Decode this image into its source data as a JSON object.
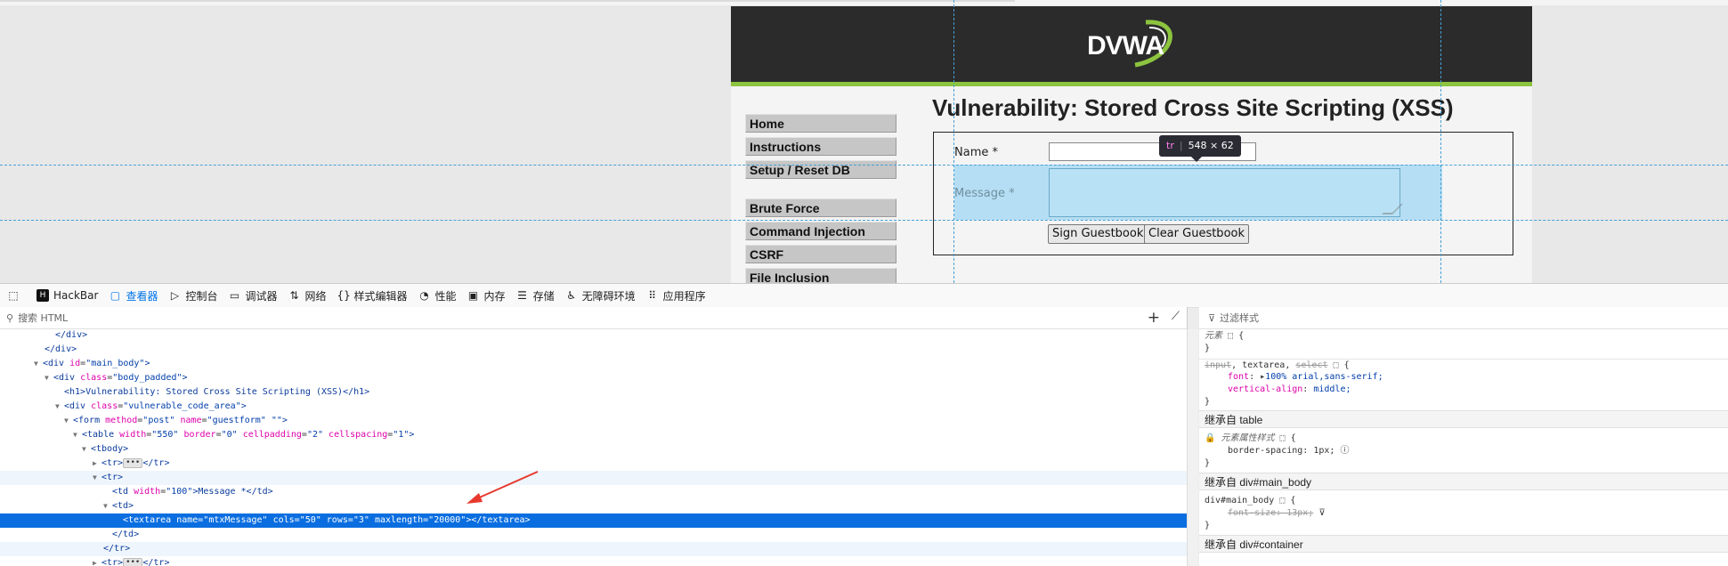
{
  "dvwa": {
    "logo_text": "DVWA",
    "menu": [
      "Home",
      "Instructions",
      "Setup / Reset DB",
      "Brute Force",
      "Command Injection",
      "CSRF",
      "File Inclusion"
    ],
    "title": "Vulnerability: Stored Cross Site Scripting (XSS)",
    "name_label": "Name *",
    "message_label": "Message *",
    "sign_button": "Sign Guestbook",
    "clear_button": "Clear Guestbook"
  },
  "tooltip": {
    "tag": "tr",
    "size": "548 × 62"
  },
  "devtools": {
    "tabs": [
      {
        "label": "HackBar",
        "icon": "hackbar-icon"
      },
      {
        "label": "查看器",
        "icon": "inspector-icon"
      },
      {
        "label": "控制台",
        "icon": "console-icon"
      },
      {
        "label": "调试器",
        "icon": "debugger-icon"
      },
      {
        "label": "网络",
        "icon": "network-icon"
      },
      {
        "label": "样式编辑器",
        "icon": "style-editor-icon"
      },
      {
        "label": "性能",
        "icon": "performance-icon"
      },
      {
        "label": "内存",
        "icon": "memory-icon"
      },
      {
        "label": "存储",
        "icon": "storage-icon"
      },
      {
        "label": "无障碍环境",
        "icon": "accessibility-icon"
      },
      {
        "label": "应用程序",
        "icon": "application-icon"
      }
    ],
    "active_tab": "查看器",
    "search_placeholder": "搜索 HTML",
    "filter_placeholder": "过滤样式"
  },
  "html_tree": {
    "l0": "</div>",
    "l1": "</div>",
    "l2_tag": "<div",
    "l2_an": "id",
    "l2_av": "\"main_body\"",
    "l2_end": ">",
    "l3_tag": "<div",
    "l3_an": "class",
    "l3_av": "\"body_padded\"",
    "l3_end": ">",
    "l4": "<h1>Vulnerability: Stored Cross Site Scripting (XSS)</h1>",
    "l5_tag": "<div",
    "l5_an": "class",
    "l5_av": "\"vulnerable_code_area\"",
    "l5_end": ">",
    "l6_tag": "<form",
    "l6_a1": "method",
    "l6_v1": "\"post\"",
    "l6_a2": "name",
    "l6_v2": "\"guestform\"",
    "l6_v3": "\"\"",
    "l6_end": ">",
    "l7_tag": "<table",
    "l7_a1": "width",
    "l7_v1": "\"550\"",
    "l7_a2": "border",
    "l7_v2": "\"0\"",
    "l7_a3": "cellpadding",
    "l7_v3": "\"2\"",
    "l7_a4": "cellspacing",
    "l7_v4": "\"1\"",
    "l7_end": ">",
    "l8": "<tbody>",
    "l9_open": "<tr>",
    "l9_close": "</tr>",
    "l10": "<tr>",
    "l11_tag": "<td",
    "l11_an": "width",
    "l11_av": "\"100\"",
    "l11_text": ">Message *</td>",
    "l12": "<td>",
    "l13": "<textarea name=\"mtxMessage\" cols=\"50\" rows=\"3\" maxlength=\"20000\"></textarea>",
    "l14": "</td>",
    "l15": "</tr>",
    "l16_open": "<tr>",
    "l16_close": "</tr>"
  },
  "styles": {
    "element_label": "元素",
    "rule1_selector_a": "input",
    "rule1_selector_b": ", textarea, ",
    "rule1_selector_c": "select",
    "rule1_p1": "font",
    "rule1_v1": "100% arial,sans-serif;",
    "rule1_p2": "vertical-align",
    "rule1_v2": "middle;",
    "inherit_table": "继承自 table",
    "element_attr_label": "元素属性样式",
    "table_p": "border-spacing",
    "table_v": "1px;",
    "inherit_main": "继承自 div#main_body",
    "main_selector": "div#main_body",
    "main_p": "font-size: 13px;",
    "inherit_container": "继承自 div#container"
  }
}
